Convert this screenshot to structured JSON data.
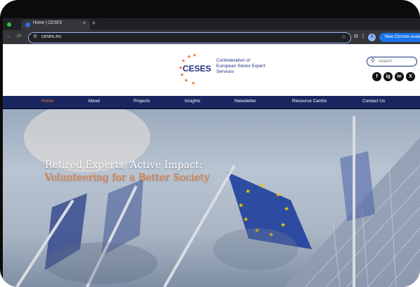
{
  "browser": {
    "tab_title": "Home | CESES",
    "tab_close": "×",
    "new_tab": "+",
    "url": "ceses.eu",
    "profile_initial": "A",
    "update_button": "New Chrome available"
  },
  "site": {
    "logo_text": "CESES",
    "tagline": "Confederation of European Senior Expert Services",
    "search_placeholder": "Search",
    "social": [
      "f",
      "ig",
      "in",
      "X"
    ],
    "nav": [
      "Home",
      "About",
      "Projects",
      "Insights",
      "Newsletter",
      "Resource Centre",
      "Contact Us"
    ],
    "active_nav": "Home"
  },
  "hero": {
    "headline": "Retired Experts, Active Impact:",
    "subheadline": "Volunteering for a Better Society"
  },
  "colors": {
    "brand_navy": "#1a2660",
    "accent_orange": "#e8762d",
    "eu_blue": "#1f3f9c",
    "eu_star": "#f2c200"
  }
}
